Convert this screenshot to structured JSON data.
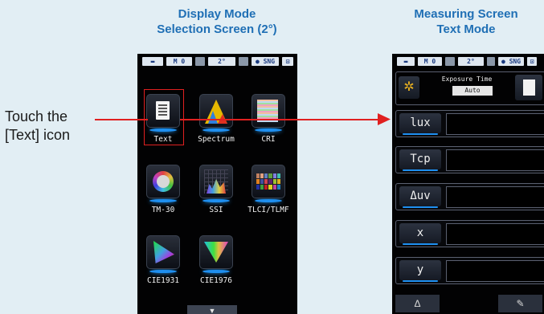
{
  "headings": {
    "left_line1": "Display Mode",
    "left_line2": "Selection Screen (2°)",
    "right_line1": "Measuring Screen",
    "right_line2": "Text Mode"
  },
  "instruction": {
    "line1": "Touch the",
    "line2": "[Text] icon"
  },
  "status_bar": {
    "memory": "M  0",
    "angle": "2°",
    "mode": "SNG"
  },
  "mode_icons": [
    {
      "label": "Text",
      "icon": "text-document-icon",
      "selected": true
    },
    {
      "label": "Spectrum",
      "icon": "spectrum-icon"
    },
    {
      "label": "CRI",
      "icon": "cri-bars-icon"
    },
    {
      "label": "TM-30",
      "icon": "tm30-circle-icon"
    },
    {
      "label": "SSI",
      "icon": "ssi-graph-icon"
    },
    {
      "label": "TLCI/TLMF",
      "icon": "color-checker-icon"
    },
    {
      "label": "CIE1931",
      "icon": "cie1931-triangle-icon"
    },
    {
      "label": "CIE1976",
      "icon": "cie1976-triangle-icon"
    }
  ],
  "scroll_down": "▼",
  "measuring": {
    "exposure_label": "Exposure Time",
    "exposure_value": "Auto",
    "rows": [
      "lux",
      "Tcp",
      "Δuv",
      "x",
      "y"
    ],
    "bottom_left_icon": "Δ"
  },
  "colors": {
    "accent_blue": "#1f6fb5",
    "highlight_red": "#e02020",
    "glow_blue": "#1e8ff0"
  }
}
